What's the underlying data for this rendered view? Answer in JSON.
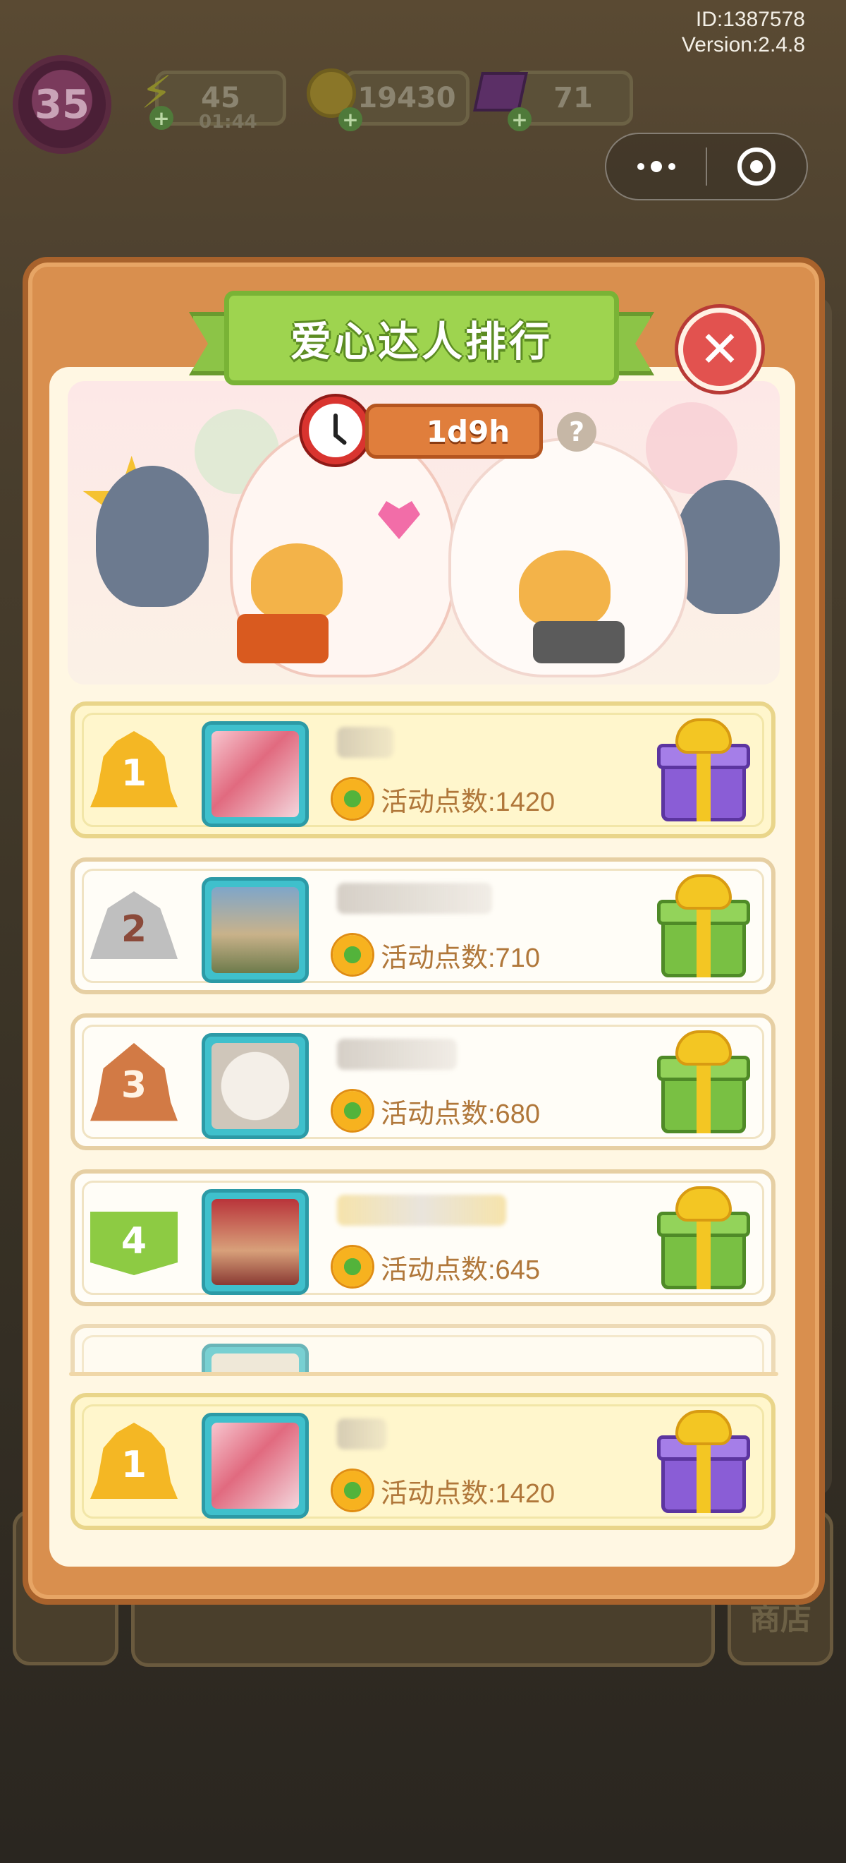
{
  "hud": {
    "id_line": "ID:1387578",
    "version_line": "Version:2.4.8",
    "level": "35",
    "energy_value": "45",
    "energy_timer": "01:44",
    "coins_value": "19430",
    "gems_value": "71",
    "capsule_more_icon": "more-dots-icon",
    "capsule_close_icon": "target-icon"
  },
  "modal": {
    "title": "爱心达人排行",
    "close_icon": "close-icon",
    "countdown": "1d9h",
    "help_symbol": "?"
  },
  "ranking": [
    {
      "rank": "1",
      "points_label": "活动点数:1420",
      "tier": "gold",
      "gift": "purple"
    },
    {
      "rank": "2",
      "points_label": "活动点数:710",
      "tier": "silver",
      "gift": "green"
    },
    {
      "rank": "3",
      "points_label": "活动点数:680",
      "tier": "bronze",
      "gift": "green"
    },
    {
      "rank": "4",
      "points_label": "活动点数:645",
      "tier": "green",
      "gift": "green"
    }
  ],
  "my_rank": {
    "rank": "1",
    "points_label": "活动点数:1420",
    "tier": "gold",
    "gift": "purple"
  },
  "background": {
    "shop_label": "商店"
  }
}
